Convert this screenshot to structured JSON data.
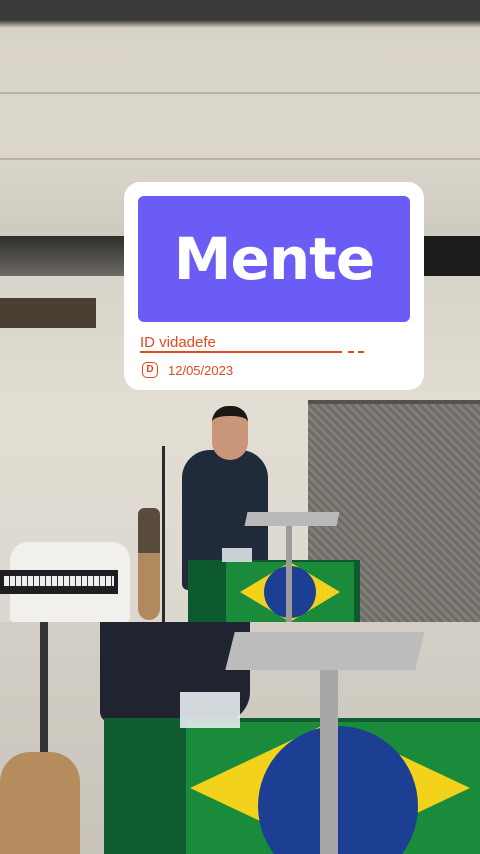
{
  "card": {
    "title": "Mente",
    "handle": "ID  vidadefe",
    "date_icon_letter": "D",
    "date": "12/05/2023"
  },
  "colors": {
    "title_box": "#6a5cf4",
    "accent": "#e2491c",
    "card_bg": "#ffffff"
  },
  "icons": {
    "date_icon": "calendar-d-icon"
  }
}
